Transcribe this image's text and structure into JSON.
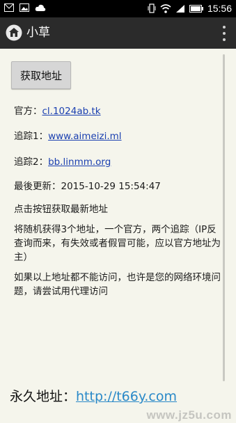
{
  "status_bar": {
    "time": "15:56",
    "left_icons": [
      "mail-icon",
      "image-icon",
      "cloud-icon"
    ],
    "right_icons": [
      "vibrate-icon",
      "wifi-icon",
      "signal-icon",
      "battery-icon"
    ]
  },
  "app_bar": {
    "title": "小草",
    "home_icon": "home-icon",
    "menu_icon": "overflow-menu-icon"
  },
  "content": {
    "get_button_label": "获取地址",
    "official": {
      "label": "官方：",
      "link": "cl.1024ab.tk"
    },
    "tracker1": {
      "label": "追踪1：",
      "link": "www.aimeizi.ml"
    },
    "tracker2": {
      "label": "追踪2：",
      "link": "bb.linmm.org"
    },
    "last_update": "最後更新：2015-10-29 15:54:47",
    "hint": "点击按钮获取最新地址",
    "description": "将随机获得3个地址，一个官方，两个追踪（IP反查询而来，有失效或者假冒可能，应以官方地址为主）",
    "notice": "如果以上地址都不能访问，也许是您的网络环境问题，请尝试用代理访问",
    "permanent": {
      "label": "永久地址：",
      "link": "http://t66y.com"
    }
  },
  "watermark": "www.jz5u.com",
  "colors": {
    "status_bar": "#000000",
    "app_bar": "#2b2b2b",
    "background": "#f5f5ec",
    "link": "#1a3fb0",
    "permanent_link": "#2a89c8"
  }
}
